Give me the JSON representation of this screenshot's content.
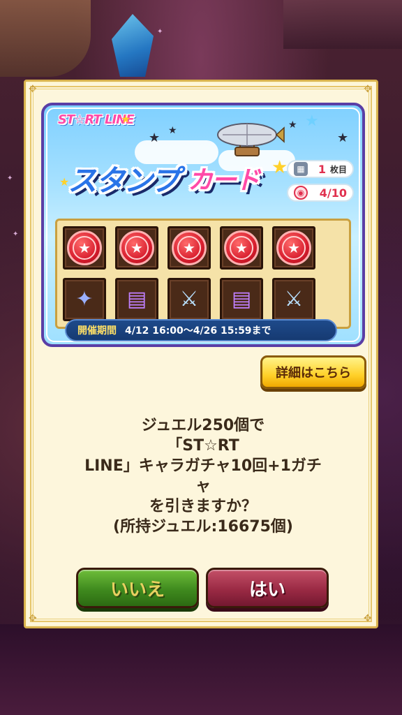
{
  "banner": {
    "logo_text": "ST☆RT LINE",
    "title_stamp": "スタンプ",
    "title_card": "カード",
    "sheet_count": "1",
    "sheet_unit": "枚目",
    "stamp_progress": "4/10",
    "stamp_progress_fraction": 0.4,
    "period_label": "開催期間",
    "period_value": "4/12  16:00〜4/26  15:59まで",
    "stamp_slots": [
      {
        "icon": "stamp-icon"
      },
      {
        "icon": "stamp-icon"
      },
      {
        "icon": "stamp-icon"
      },
      {
        "icon": "stamp-icon"
      },
      {
        "icon": "stamp-icon"
      }
    ],
    "reward_slots": [
      {
        "icon": "star-crystal-icon"
      },
      {
        "icon": "magic-book-icon"
      },
      {
        "icon": "sword-icon"
      },
      {
        "icon": "magic-book-icon"
      },
      {
        "icon": "sword-icon"
      }
    ]
  },
  "details_button": "詳細はこちら",
  "message": {
    "line1": "ジュエル250個で",
    "line2": "「ST☆RT",
    "line3": "LINE」キャラガチャ10回+1ガチ",
    "line4": "ャ",
    "line5": "を引きますか？",
    "line6": "(所持ジュエル:16675個)"
  },
  "buttons": {
    "no": "いいえ",
    "yes": "はい"
  },
  "colors": {
    "dialog_bg": "#fdf6dc",
    "dialog_border": "#d9b34e",
    "banner_border": "#5a3ea6",
    "stamp_red": "#d81e2e",
    "no_green": "#3f8a1e",
    "yes_red": "#9a2a44",
    "details_yellow": "#ffd12a"
  }
}
